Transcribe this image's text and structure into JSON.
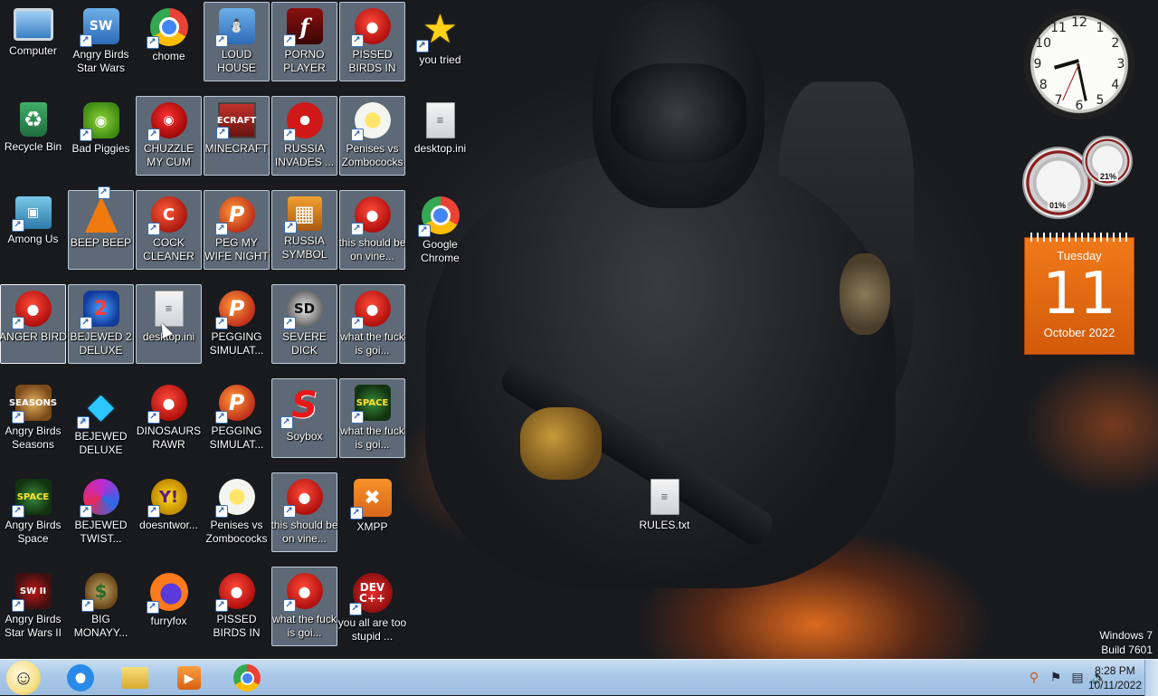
{
  "desktop": {
    "icons": [
      {
        "label": "Computer",
        "glyph": "computer-icon",
        "cls": "g-computer",
        "sym": ""
      },
      {
        "label": "Angry Birds Star Wars",
        "glyph": "angry-birds-star-wars-icon",
        "cls": "g-birdbox",
        "sym": "SW"
      },
      {
        "label": "chome",
        "glyph": "chrome-icon",
        "cls": "g-chrome",
        "sym": ""
      },
      {
        "label": "LOUD HOUSE",
        "glyph": "penguin-icon",
        "cls": "g-birdbox",
        "sym": "⛄"
      },
      {
        "label": "PORNO PLAYER",
        "glyph": "flash-player-icon",
        "cls": "g-flash",
        "sym": "f"
      },
      {
        "label": "PISSED BIRDS IN VIDEO G...",
        "glyph": "angry-bird-icon",
        "cls": "g-bird",
        "sym": "●"
      },
      {
        "label": "you tried",
        "glyph": "star-icon",
        "cls": "g-star",
        "sym": "★"
      },
      {
        "label": "Recycle Bin",
        "glyph": "recycle-bin-icon",
        "cls": "g-bin",
        "sym": "♻"
      },
      {
        "label": "Bad Piggies",
        "glyph": "pig-icon",
        "cls": "g-pig",
        "sym": "◉"
      },
      {
        "label": "CHUZZLE MY CUM",
        "glyph": "chuzzle-icon",
        "cls": "g-red",
        "sym": "◉"
      },
      {
        "label": "MINECRAFT",
        "glyph": "minecraft-icon",
        "cls": "g-craft",
        "sym": "ECRAFT"
      },
      {
        "label": "RUSSIA INVADES ...",
        "glyph": "radiation-icon",
        "cls": "g-nuke",
        "sym": ""
      },
      {
        "label": "Penises vs Zombococks",
        "glyph": "plants-vs-zombies-icon",
        "cls": "g-flower",
        "sym": ""
      },
      {
        "label": "desktop.ini",
        "glyph": "settings-file-icon",
        "cls": "g-file",
        "sym": "≡"
      },
      {
        "label": "Among Us",
        "glyph": "among-us-icon",
        "cls": "g-among",
        "sym": "▣"
      },
      {
        "label": "BEEP BEEP",
        "glyph": "vlc-cone-icon",
        "cls": "g-cone",
        "sym": ""
      },
      {
        "label": "COCK CLEANER",
        "glyph": "ccleaner-icon",
        "cls": "g-cc",
        "sym": "C"
      },
      {
        "label": "PEG MY WIFE NIGHT",
        "glyph": "peggle-icon",
        "cls": "g-p",
        "sym": "P"
      },
      {
        "label": "RUSSIA SYMBOL",
        "glyph": "blocks-icon",
        "cls": "g-blocks",
        "sym": "▦"
      },
      {
        "label": "this should be on vine...",
        "glyph": "angry-bird-icon",
        "cls": "g-bird",
        "sym": "●"
      },
      {
        "label": "Google Chrome",
        "glyph": "chrome-icon",
        "cls": "g-chrome",
        "sym": ""
      },
      {
        "label": "ANGER BIRD",
        "glyph": "angry-bird-icon",
        "cls": "g-bird",
        "sym": "●"
      },
      {
        "label": "BEJEWED 2 DELUXE",
        "glyph": "bejeweled-2-icon",
        "cls": "g-gem2",
        "sym": "2"
      },
      {
        "label": "desktop.ini",
        "glyph": "settings-file-icon",
        "cls": "g-file",
        "sym": "≡"
      },
      {
        "label": "PEGGING SIMULAT...",
        "glyph": "peggle-icon",
        "cls": "g-p",
        "sym": "P"
      },
      {
        "label": "SEVERE DICK",
        "glyph": "daemon-tools-icon",
        "cls": "g-sd",
        "sym": "SD"
      },
      {
        "label": "what the fuck is goi...",
        "glyph": "angry-bird-icon",
        "cls": "g-bird",
        "sym": "●"
      },
      {
        "label": "Angry Birds Seasons",
        "glyph": "angry-birds-seasons-icon",
        "cls": "g-seasons",
        "sym": "SEASONS"
      },
      {
        "label": "BEJEWED DELUXE",
        "glyph": "diamond-icon",
        "cls": "g-diamond",
        "sym": "◆"
      },
      {
        "label": "DINOSAURS RAWR",
        "glyph": "angry-bird-icon",
        "cls": "g-bird",
        "sym": "●"
      },
      {
        "label": "PEGGING SIMULAT...",
        "glyph": "peggle-icon",
        "cls": "g-p",
        "sym": "P"
      },
      {
        "label": "Soybox",
        "glyph": "soybox-icon",
        "cls": "g-soybox",
        "sym": "S"
      },
      {
        "label": "what the fuck is goi...",
        "glyph": "angry-birds-space-icon",
        "cls": "g-space",
        "sym": "SPACE"
      },
      {
        "label": "Angry Birds Space",
        "glyph": "angry-birds-space-icon",
        "cls": "g-space",
        "sym": "SPACE"
      },
      {
        "label": "BEJEWED TWIST...",
        "glyph": "bejeweled-twist-icon",
        "cls": "g-twist",
        "sym": ""
      },
      {
        "label": "doesntwor...",
        "glyph": "yahoo-messenger-icon",
        "cls": "g-yahoo",
        "sym": "Y!"
      },
      {
        "label": "Penises vs Zombococks",
        "glyph": "plants-vs-zombies-icon",
        "cls": "g-flower",
        "sym": ""
      },
      {
        "label": "this should be on vine...",
        "glyph": "angry-bird-icon",
        "cls": "g-bird",
        "sym": "●"
      },
      {
        "label": "XMPP",
        "glyph": "xampp-icon",
        "cls": "g-xmpp",
        "sym": "✖"
      },
      {
        "label": "RULES.txt",
        "glyph": "text-file-icon",
        "cls": "g-file",
        "sym": "≡"
      },
      {
        "label": "Angry Birds Star Wars II",
        "glyph": "angry-birds-star-wars-2-icon",
        "cls": "g-sw2",
        "sym": "SW II"
      },
      {
        "label": "BIG MONAYY...",
        "glyph": "money-bag-icon",
        "cls": "g-money",
        "sym": "$"
      },
      {
        "label": "furryfox",
        "glyph": "firefox-icon",
        "cls": "g-fox",
        "sym": ""
      },
      {
        "label": "PISSED BIRDS IN VIDEO G...",
        "glyph": "angry-bird-icon",
        "cls": "g-bird",
        "sym": "●"
      },
      {
        "label": "what the fuck is goi...",
        "glyph": "angry-bird-icon",
        "cls": "g-bird",
        "sym": "●"
      },
      {
        "label": "you all are too stupid ...",
        "glyph": "dev-cpp-icon",
        "cls": "g-dev",
        "sym": "DEV C++"
      }
    ]
  },
  "gadgets": {
    "clock": {
      "numbers": [
        "12",
        "1",
        "2",
        "3",
        "4",
        "5",
        "6",
        "7",
        "8",
        "9",
        "10",
        "11"
      ]
    },
    "meter": {
      "cpu": "01%",
      "memory": "21%"
    },
    "calendar": {
      "day": "Tuesday",
      "date": "11",
      "month": "October 2022"
    }
  },
  "watermark": {
    "line1": "Windows 7",
    "line2": "Build 7601"
  },
  "taskbar": {
    "time": "8:28 PM",
    "date": "10/11/2022",
    "pinned": [
      "internet-explorer-icon",
      "windows-explorer-icon",
      "media-player-icon",
      "chrome-icon"
    ]
  },
  "colors": {
    "taskbar": "#a9c8e8",
    "calendar": "#f07a1a",
    "selection": "#bed7f0"
  }
}
